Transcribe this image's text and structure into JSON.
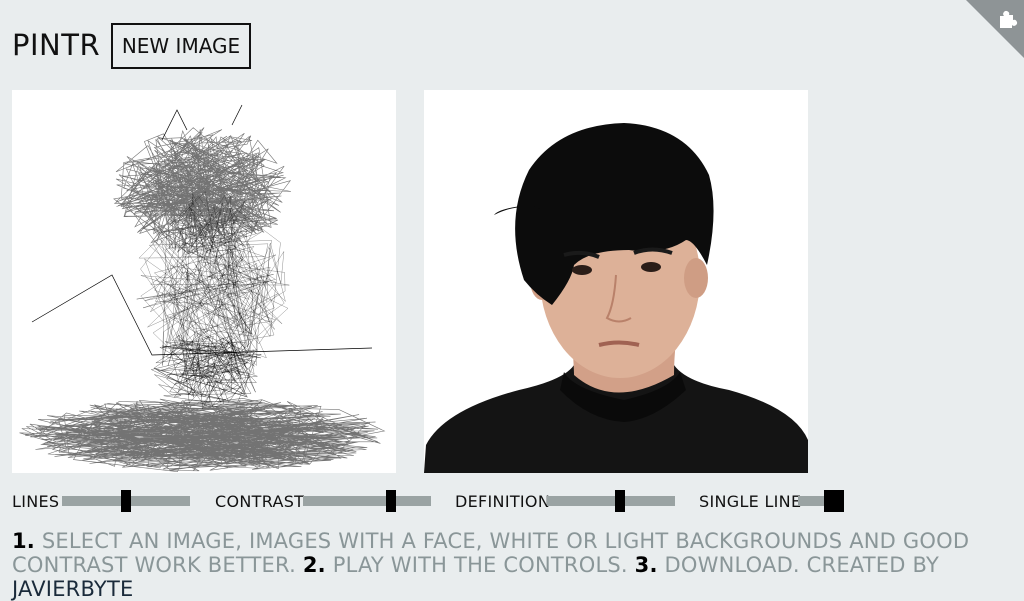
{
  "app": {
    "title": "PINTR",
    "new_image_label": "NEW IMAGE"
  },
  "corner": {
    "icon": "puzzle-icon"
  },
  "controls": [
    {
      "label": "LINES",
      "value": 0.5
    },
    {
      "label": "CONTRAST",
      "value": 0.7
    },
    {
      "label": "DEFINITION",
      "value": 0.58
    },
    {
      "label": "SINGLE LINE",
      "value": 0
    }
  ],
  "instructions": {
    "n1": "1.",
    "t1": " SELECT AN IMAGE, IMAGES WITH A FACE, WHITE OR LIGHT BACKGROUNDS AND GOOD CONTRAST WORK BETTER. ",
    "n2": "2.",
    "t2": " PLAY WITH THE CONTROLS. ",
    "n3": "3.",
    "t3": " DOWNLOAD. CREATED BY ",
    "author": "JAVIERBYTE"
  },
  "colors": {
    "background": "#e9edee",
    "slider_track": "#9aa3a3",
    "instruction_text": "#8a9698"
  }
}
